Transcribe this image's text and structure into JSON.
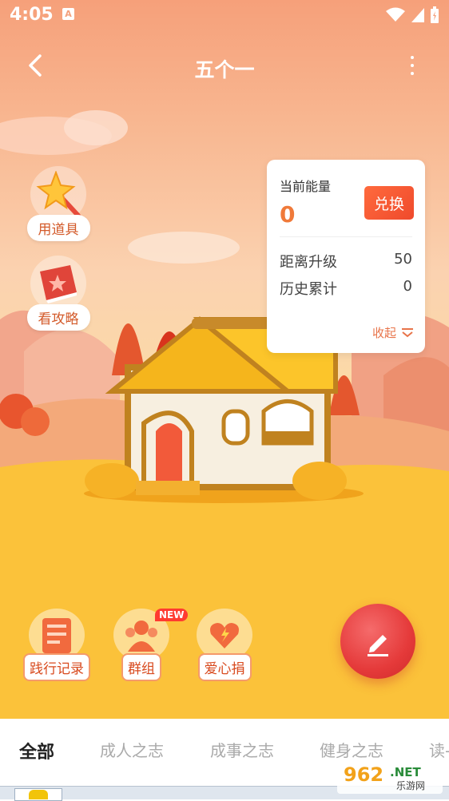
{
  "status_bar": {
    "time": "4:05",
    "notif_letter": "A"
  },
  "header": {
    "title": "五个一"
  },
  "side_tools": [
    {
      "label": "用道具",
      "icon": "magic-wand-icon"
    },
    {
      "label": "看攻略",
      "icon": "guide-book-icon"
    }
  ],
  "energy_card": {
    "current_label": "当前能量",
    "current_value": "0",
    "exchange_label": "兑换",
    "upgrade_label": "距离升级",
    "upgrade_value": "50",
    "history_label": "历史累计",
    "history_value": "0",
    "collapse_label": "收起"
  },
  "bottom_tools": [
    {
      "label": "践行记录",
      "icon": "record-icon"
    },
    {
      "label": "群组",
      "icon": "group-icon",
      "badge": "NEW"
    },
    {
      "label": "爱心捐",
      "icon": "donate-icon"
    }
  ],
  "tabs": [
    {
      "label": "全部",
      "active": true
    },
    {
      "label": "成人之志",
      "active": false
    },
    {
      "label": "成事之志",
      "active": false
    },
    {
      "label": "健身之志",
      "active": false
    },
    {
      "label": "读-",
      "active": false
    }
  ],
  "watermark": {
    "number": "962",
    "suffix": ".NET",
    "sub": "乐游网"
  },
  "colors": {
    "accent": "#f07a3a",
    "exchange": "#ef4a2c",
    "fab": "#e53a3a"
  }
}
